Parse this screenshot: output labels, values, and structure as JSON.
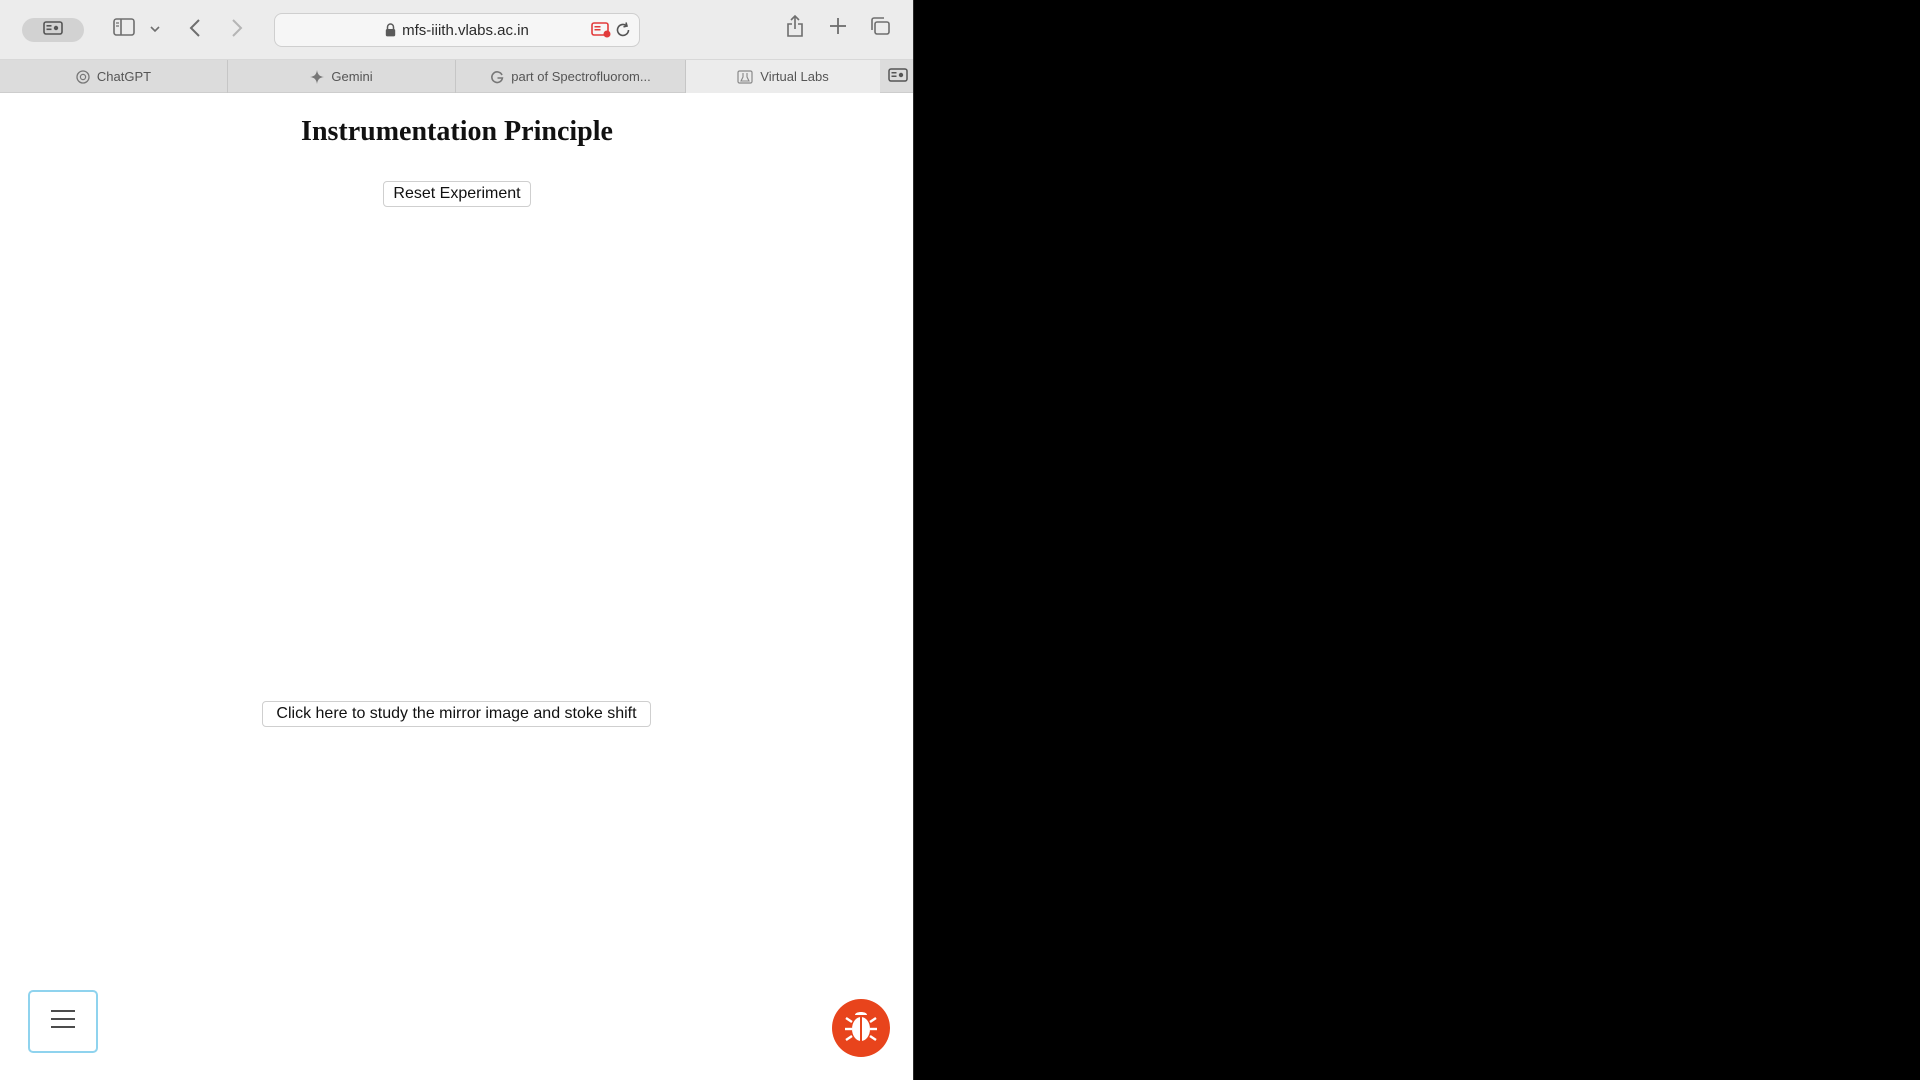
{
  "browser": {
    "url": "mfs-iiith.vlabs.ac.in",
    "tabs": [
      {
        "label": "ChatGPT",
        "icon": "chatgpt-icon"
      },
      {
        "label": "Gemini",
        "icon": "gemini-icon"
      },
      {
        "label": "part of Spectrofluorom...",
        "icon": "google-icon"
      },
      {
        "label": "Virtual Labs",
        "icon": "virtual-labs-icon",
        "active": true
      }
    ]
  },
  "page": {
    "title": "Instrumentation Principle",
    "reset_label": "Reset Experiment",
    "mirror_label": "Click here to study the mirror image and stoke shift"
  },
  "colors": {
    "bug_button": "#e8441c",
    "menu_border": "#8fd3ee"
  }
}
